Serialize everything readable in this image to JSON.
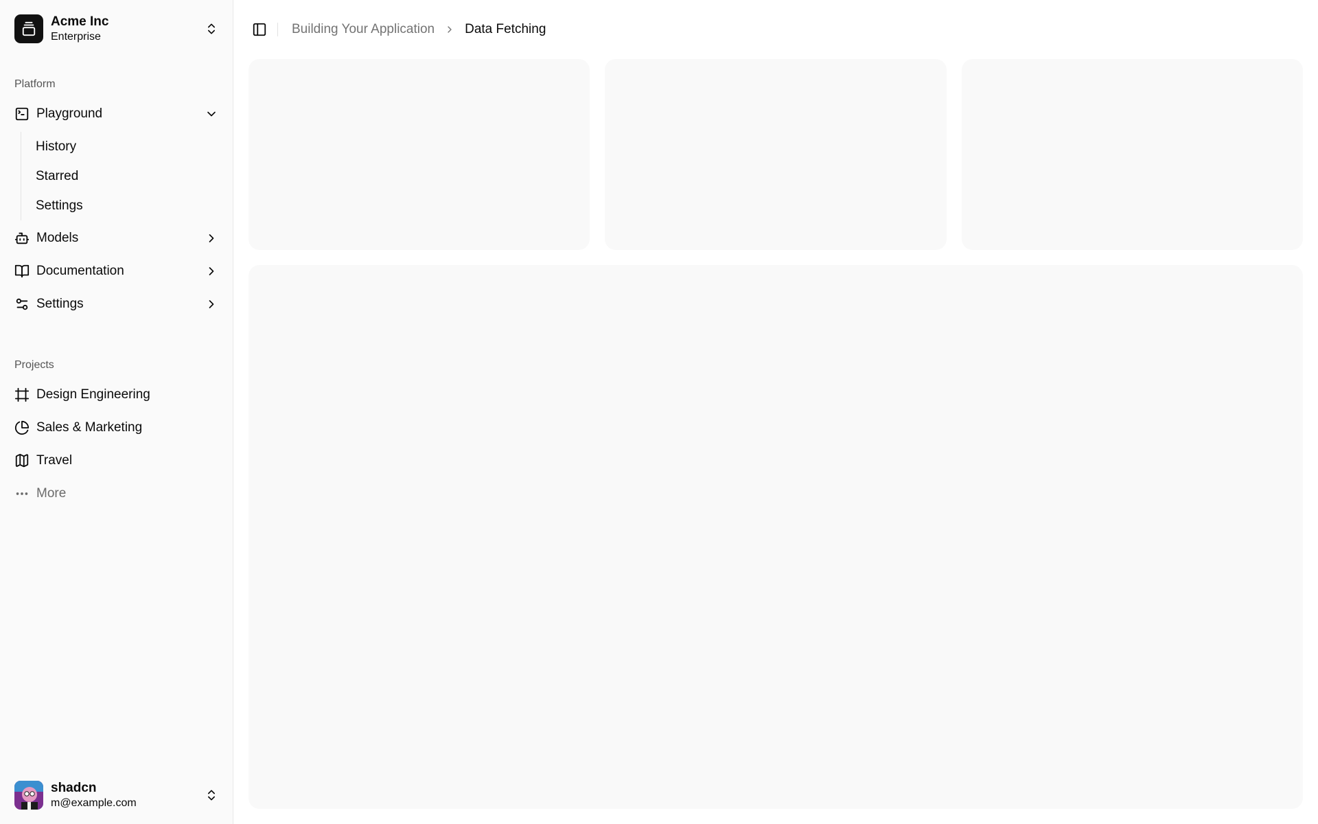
{
  "team": {
    "name": "Acme Inc",
    "plan": "Enterprise"
  },
  "platform": {
    "label": "Platform",
    "items": [
      {
        "label": "Playground",
        "icon": "terminal-square-icon",
        "expanded": true,
        "children": [
          "History",
          "Starred",
          "Settings"
        ]
      },
      {
        "label": "Models",
        "icon": "bot-icon"
      },
      {
        "label": "Documentation",
        "icon": "book-open-icon"
      },
      {
        "label": "Settings",
        "icon": "settings-sliders-icon"
      }
    ]
  },
  "projects": {
    "label": "Projects",
    "items": [
      {
        "label": "Design Engineering",
        "icon": "frame-icon"
      },
      {
        "label": "Sales & Marketing",
        "icon": "pie-chart-icon"
      },
      {
        "label": "Travel",
        "icon": "map-icon"
      },
      {
        "label": "More",
        "icon": "more-horizontal-icon"
      }
    ]
  },
  "user": {
    "name": "shadcn",
    "email": "m@example.com"
  },
  "breadcrumb": {
    "parent": "Building Your Application",
    "current": "Data Fetching"
  }
}
